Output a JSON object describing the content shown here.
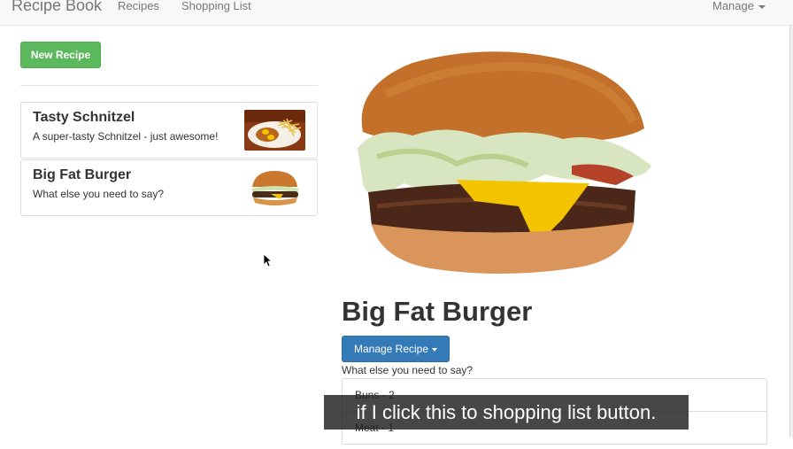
{
  "navbar": {
    "brand": "Recipe Book",
    "links": [
      "Recipes",
      "Shopping List"
    ],
    "manage": "Manage"
  },
  "left": {
    "new_recipe": "New Recipe",
    "recipes": [
      {
        "title": "Tasty Schnitzel",
        "description": "A super-tasty Schnitzel - just awesome!",
        "thumb": "schnitzel-thumbnail"
      },
      {
        "title": "Big Fat Burger",
        "description": "What else you need to say?",
        "thumb": "burger-thumbnail"
      }
    ]
  },
  "detail": {
    "title": "Big Fat Burger",
    "manage_button": "Manage Recipe",
    "description": "What else you need to say?",
    "ingredients": [
      "Buns - 2",
      "Meat - 1"
    ]
  },
  "subtitle": "if I click this to shopping list button.",
  "colors": {
    "success": "#5cb85c",
    "primary": "#337ab7"
  }
}
